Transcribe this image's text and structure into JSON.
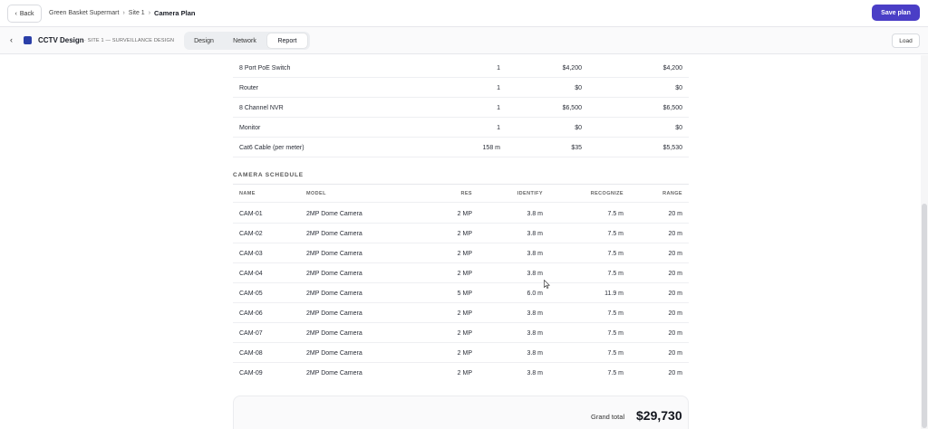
{
  "topbar": {
    "back_label": "Back",
    "breadcrumbs": [
      "Green Basket Supermart",
      "Site 1",
      "Camera Plan"
    ],
    "save_label": "Save plan"
  },
  "subbar": {
    "app_title": "CCTV Design",
    "app_subtitle": "· SITE 1 — SURVEILLANCE DESIGN",
    "tabs": [
      "Design",
      "Network",
      "Report"
    ],
    "active_tab": "Report",
    "load_label": "Load"
  },
  "equipment": [
    {
      "name": "8 Port PoE Switch",
      "qty": "1",
      "unit": "$4,200",
      "total": "$4,200"
    },
    {
      "name": "Router",
      "qty": "1",
      "unit": "$0",
      "total": "$0"
    },
    {
      "name": "8 Channel NVR",
      "qty": "1",
      "unit": "$6,500",
      "total": "$6,500"
    },
    {
      "name": "Monitor",
      "qty": "1",
      "unit": "$0",
      "total": "$0"
    },
    {
      "name": "Cat6 Cable (per meter)",
      "qty": "158 m",
      "unit": "$35",
      "total": "$5,530"
    }
  ],
  "camera_schedule": {
    "title": "CAMERA SCHEDULE",
    "columns": [
      "NAME",
      "MODEL",
      "RES",
      "IDENTIFY",
      "RECOGNIZE",
      "RANGE"
    ],
    "rows": [
      {
        "name": "CAM-01",
        "model": "2MP Dome Camera",
        "res": "2 MP",
        "identify": "3.8 m",
        "recognize": "7.5 m",
        "range": "20 m"
      },
      {
        "name": "CAM-02",
        "model": "2MP Dome Camera",
        "res": "2 MP",
        "identify": "3.8 m",
        "recognize": "7.5 m",
        "range": "20 m"
      },
      {
        "name": "CAM-03",
        "model": "2MP Dome Camera",
        "res": "2 MP",
        "identify": "3.8 m",
        "recognize": "7.5 m",
        "range": "20 m"
      },
      {
        "name": "CAM-04",
        "model": "2MP Dome Camera",
        "res": "2 MP",
        "identify": "3.8 m",
        "recognize": "7.5 m",
        "range": "20 m"
      },
      {
        "name": "CAM-05",
        "model": "2MP Dome Camera",
        "res": "5 MP",
        "identify": "6.0 m",
        "recognize": "11.9 m",
        "range": "20 m"
      },
      {
        "name": "CAM-06",
        "model": "2MP Dome Camera",
        "res": "2 MP",
        "identify": "3.8 m",
        "recognize": "7.5 m",
        "range": "20 m"
      },
      {
        "name": "CAM-07",
        "model": "2MP Dome Camera",
        "res": "2 MP",
        "identify": "3.8 m",
        "recognize": "7.5 m",
        "range": "20 m"
      },
      {
        "name": "CAM-08",
        "model": "2MP Dome Camera",
        "res": "2 MP",
        "identify": "3.8 m",
        "recognize": "7.5 m",
        "range": "20 m"
      },
      {
        "name": "CAM-09",
        "model": "2MP Dome Camera",
        "res": "2 MP",
        "identify": "3.8 m",
        "recognize": "7.5 m",
        "range": "20 m"
      }
    ]
  },
  "totals": {
    "label": "Grand total",
    "value": "$29,730"
  },
  "colors": {
    "accent": "#4a3ec6",
    "logo": "#2b3fa8"
  }
}
